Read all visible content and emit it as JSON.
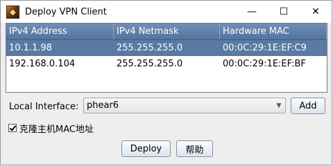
{
  "window": {
    "title": "Deploy VPN Client",
    "controls": [
      "—",
      "☐",
      "✕"
    ]
  },
  "table": {
    "columns": [
      "IPv4 Address",
      "IPv4 Netmask",
      "Hardware MAC"
    ],
    "rows": [
      {
        "ip": "10.1.1.98",
        "netmask": "255.255.255.0",
        "mac": "00:0C:29:1E:EF:C9",
        "selected": true
      },
      {
        "ip": "192.168.0.104",
        "netmask": "255.255.255.0",
        "mac": "00:0C:29:1E:EF:BF",
        "selected": false
      }
    ]
  },
  "local_interface": {
    "label": "Local Interface:",
    "value": "phear6",
    "add_label": "Add"
  },
  "clone_mac": {
    "label": "克隆主机MAC地址",
    "checked": true
  },
  "actions": {
    "deploy_label": "Deploy",
    "help_label": "帮助"
  },
  "colors": {
    "header_bg": "#5a7aa2",
    "selected_row": "#5a7aa2"
  }
}
